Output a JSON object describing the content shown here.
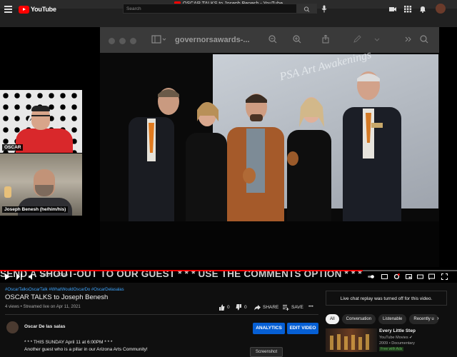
{
  "window": {
    "title": "OSCAR TALKS to Joseph Benesh - YouTube"
  },
  "header": {
    "logo_text": "YouTube",
    "search_placeholder": "Search"
  },
  "stage": {
    "finder_title": "governorsawards-...",
    "screen_text": "PSA Art Awakenings"
  },
  "tiles": [
    {
      "label": "OSCAR"
    },
    {
      "label": "Joseph Benesh (he/him/his)"
    }
  ],
  "banner": {
    "text": "SEND A SHOUT-OUT TO OUR GUEST * * * USE THE COMMENTS OPTION * * *"
  },
  "player": {
    "time": "0:00 / 1:00:00"
  },
  "video": {
    "hashtags": "#OscarTalksOscarTalk #WhatWouldOscarDo #OscarDelasalas",
    "title": "OSCAR TALKS to Joseph Benesh",
    "meta": "4 views • Streamed live on Apr 11, 2021",
    "likes": "0",
    "dislikes": "0",
    "share_label": "SHARE",
    "save_label": "SAVE",
    "more_label": "•••"
  },
  "channel": {
    "name": "Oscar De las salas",
    "analytics_label": "ANALYTICS",
    "edit_label": "EDIT VIDEO"
  },
  "description": {
    "line1": "* * * THIS SUNDAY April 11 at 6:00PM * * *",
    "line2": "Another guest who is a pillar in our Arizona Arts Community!",
    "screenshot_label": "Screenshot"
  },
  "chat": {
    "notice": "Live chat replay was turned off for this video."
  },
  "chips": [
    "All",
    "Conversation",
    "Listenable",
    "Recently u"
  ],
  "related": {
    "title": "Every Little Step",
    "channel": "YouTube Movies ✔",
    "meta": "2009 • Documentary",
    "badge": "Free with Ads"
  },
  "colors": {
    "accent": "#ff0000",
    "link": "#3ea6ff",
    "button": "#065fd4",
    "background": "#0f0f0f"
  }
}
